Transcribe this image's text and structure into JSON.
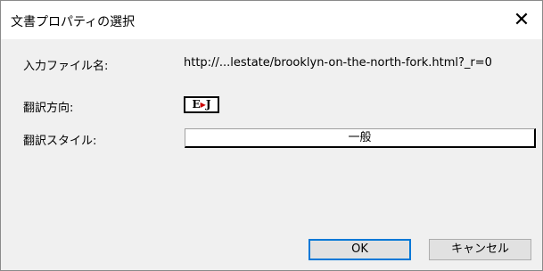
{
  "window": {
    "title": "文書プロパティの選択",
    "close_glyph": "✕"
  },
  "form": {
    "input_file_label": "入力ファイル名:",
    "input_file_value": "http://...lestate/brooklyn-on-the-north-fork.html?_r=0",
    "direction_label": "翻訳方向:",
    "direction_icon": {
      "from": "E",
      "arrow": "▶",
      "to": "J"
    },
    "style_label": "翻訳スタイル:",
    "style_value": "一般"
  },
  "buttons": {
    "ok_label": "OK",
    "cancel_label": "キャンセル"
  },
  "colors": {
    "accent": "#0078d7",
    "arrow": "#cc0000",
    "dialog_background": "#f0f0f0"
  }
}
